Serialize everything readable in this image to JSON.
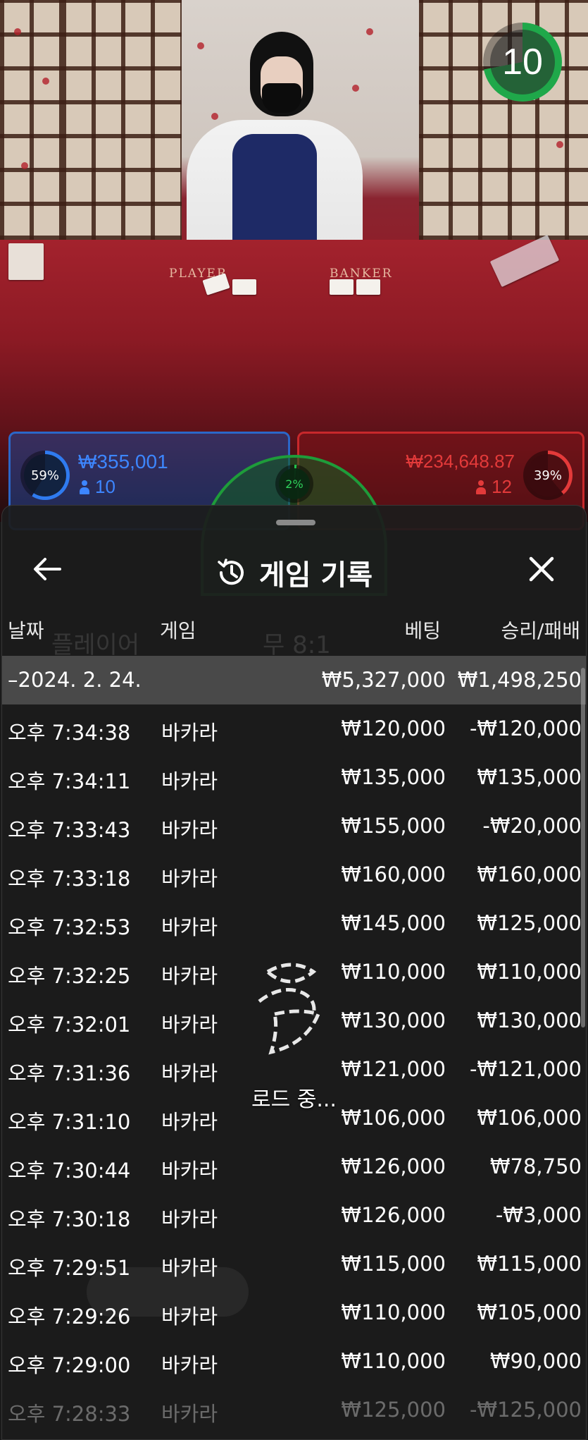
{
  "timer": {
    "value": "10",
    "progress_fraction": 0.72
  },
  "table_labels": {
    "player": "PLAYER",
    "banker": "BANKER"
  },
  "bets": {
    "player": {
      "percent": "59%",
      "amount": "₩355,001",
      "players": "10",
      "color": "#2b67c8"
    },
    "tie": {
      "percent": "2%",
      "color": "#1e9c3a"
    },
    "banker": {
      "percent": "39%",
      "amount": "₩234,648.87",
      "players": "12",
      "color": "#c8282b"
    }
  },
  "history": {
    "title": "게임 기록",
    "icons": {
      "back": "arrow-left-icon",
      "title": "history-icon",
      "close": "close-icon"
    },
    "columns": {
      "date": "날짜",
      "game": "게임",
      "bet": "베팅",
      "result": "승리/패배"
    },
    "date_group": {
      "label": "–2024. 2. 24.",
      "bet_total": "₩5,327,000",
      "result_total": "₩1,498,250"
    },
    "rows": [
      {
        "time": "오후 7:34:38",
        "game": "바카라",
        "bet": "₩120,000",
        "result": "-₩120,000"
      },
      {
        "time": "오후 7:34:11",
        "game": "바카라",
        "bet": "₩135,000",
        "result": "₩135,000"
      },
      {
        "time": "오후 7:33:43",
        "game": "바카라",
        "bet": "₩155,000",
        "result": "-₩20,000"
      },
      {
        "time": "오후 7:33:18",
        "game": "바카라",
        "bet": "₩160,000",
        "result": "₩160,000"
      },
      {
        "time": "오후 7:32:53",
        "game": "바카라",
        "bet": "₩145,000",
        "result": "₩125,000"
      },
      {
        "time": "오후 7:32:25",
        "game": "바카라",
        "bet": "₩110,000",
        "result": "₩110,000"
      },
      {
        "time": "오후 7:32:01",
        "game": "바카라",
        "bet": "₩130,000",
        "result": "₩130,000"
      },
      {
        "time": "오후 7:31:36",
        "game": "바카라",
        "bet": "₩121,000",
        "result": "-₩121,000"
      },
      {
        "time": "오후 7:31:10",
        "game": "바카라",
        "bet": "₩106,000",
        "result": "₩106,000"
      },
      {
        "time": "오후 7:30:44",
        "game": "바카라",
        "bet": "₩126,000",
        "result": "₩78,750"
      },
      {
        "time": "오후 7:30:18",
        "game": "바카라",
        "bet": "₩126,000",
        "result": "-₩3,000"
      },
      {
        "time": "오후 7:29:51",
        "game": "바카라",
        "bet": "₩115,000",
        "result": "₩115,000"
      },
      {
        "time": "오후 7:29:26",
        "game": "바카라",
        "bet": "₩110,000",
        "result": "₩105,000"
      },
      {
        "time": "오후 7:29:00",
        "game": "바카라",
        "bet": "₩110,000",
        "result": "₩90,000"
      },
      {
        "time": "오후 7:28:33",
        "game": "바카라",
        "bet": "₩125,000",
        "result": "-₩125,000"
      }
    ],
    "loading_text": "로드 중..."
  },
  "colors": {
    "accent_green": "#1fa84a",
    "player_blue": "#2f7bf0",
    "banker_red": "#e43a3a",
    "sheet_bg": "#1c1c1c"
  }
}
